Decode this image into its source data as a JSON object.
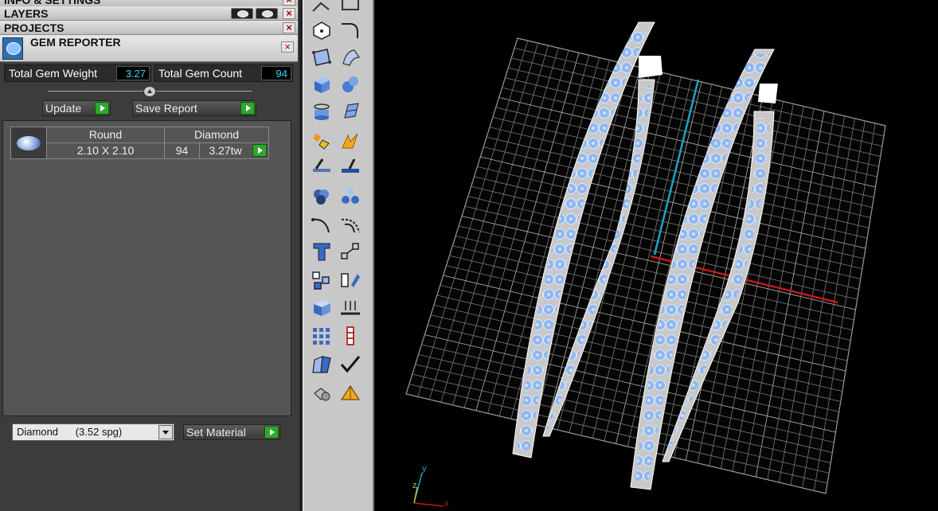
{
  "panels": {
    "info_settings": "INFO & SETTINGS",
    "layers": "LAYERS",
    "projects": "PROJECTS",
    "gem_reporter": "GEM REPORTER",
    "close_glyph": "×"
  },
  "gem_reporter": {
    "total_weight_label": "Total Gem Weight",
    "total_weight_value": "3.27",
    "total_count_label": "Total Gem Count",
    "total_count_value": "94",
    "update_label": "Update",
    "save_report_label": "Save Report",
    "gem": {
      "shape": "Round",
      "material": "Diamond",
      "size": "2.10 X 2.10",
      "count": "94",
      "weight": "3.27tw"
    },
    "material_select": "Diamond      (3.52 spg)",
    "set_material_label": "Set Material"
  },
  "viewport": {
    "axis_y": "y",
    "axis_z": "z",
    "axis_x": "x"
  },
  "colors": {
    "accent_cyan": "#2bd4ff",
    "play_green": "#2ea82e",
    "gem_blue": "#8fb7f0",
    "grid": "#9a9a9a",
    "axis_red": "#c21a1a",
    "axis_cyan": "#1aa6c4"
  }
}
